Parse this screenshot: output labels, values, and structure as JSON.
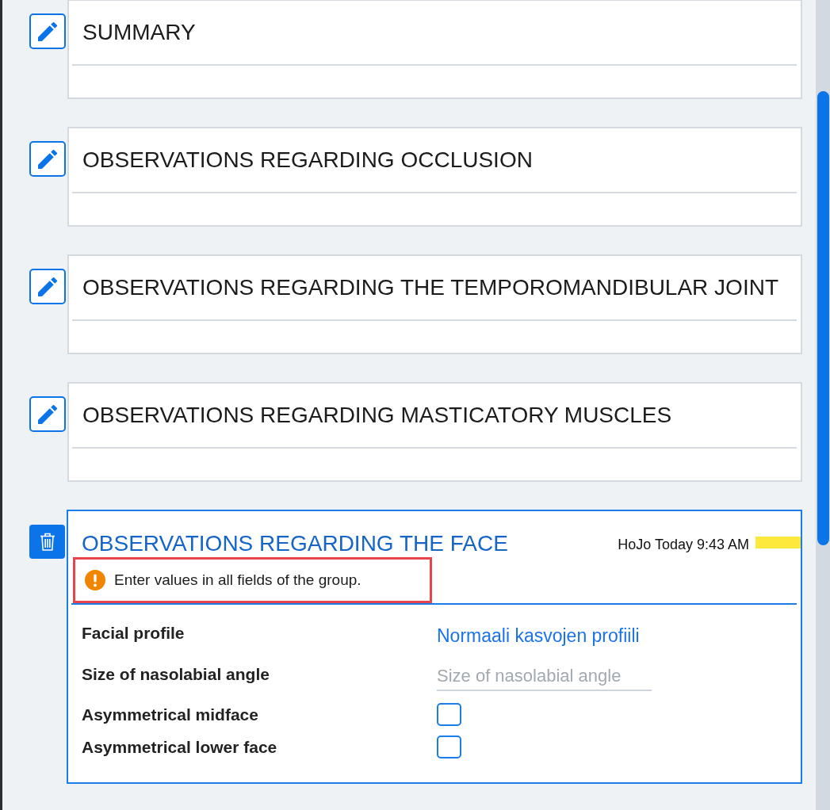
{
  "sections": [
    {
      "title": "SUMMARY",
      "expanded": false
    },
    {
      "title": "OBSERVATIONS REGARDING OCCLUSION",
      "expanded": false
    },
    {
      "title": "OBSERVATIONS REGARDING THE TEMPOROMANDIBULAR JOINT",
      "expanded": false
    },
    {
      "title": "OBSERVATIONS REGARDING MASTICATORY MUSCLES",
      "expanded": false
    },
    {
      "title": "OBSERVATIONS REGARDING THE FACE",
      "expanded": true,
      "author_time": "HoJo Today 9:43 AM",
      "color": "#fde93b",
      "warning": "Enter values in all fields of the group.",
      "fields": [
        {
          "kind": "value",
          "label": "Facial profile",
          "value": "Normaali kasvojen profiili"
        },
        {
          "kind": "input",
          "label": "Size of nasolabial angle",
          "placeholder": "Size of nasolabial angle"
        },
        {
          "kind": "checkbox",
          "label": "Asymmetrical midface",
          "checked": false
        },
        {
          "kind": "checkbox",
          "label": "Asymmetrical lower face",
          "checked": false
        }
      ]
    }
  ]
}
